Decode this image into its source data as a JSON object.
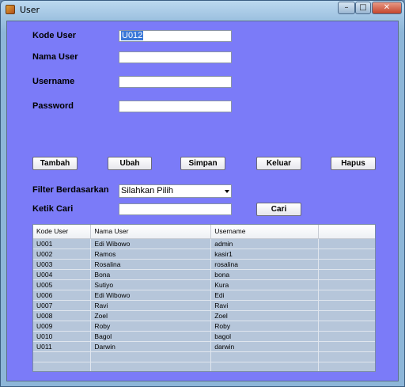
{
  "window": {
    "title": "User",
    "minimize": "–",
    "maximize": "□",
    "close": "✕"
  },
  "form": {
    "kode_user_label": "Kode User",
    "kode_user_value": "U012",
    "nama_user_label": "Nama User",
    "nama_user_value": "",
    "username_label": "Username",
    "username_value": "",
    "password_label": "Password",
    "password_value": ""
  },
  "buttons": {
    "tambah": "Tambah",
    "ubah": "Ubah",
    "simpan": "Simpan",
    "keluar": "Keluar",
    "hapus": "Hapus",
    "cari": "Cari"
  },
  "filter": {
    "label": "Filter Berdasarkan",
    "selected": "Silahkan Pilih",
    "search_label": "Ketik Cari",
    "search_value": ""
  },
  "table": {
    "headers": [
      "Kode User",
      "Nama User",
      "Username",
      ""
    ],
    "rows": [
      [
        "U001",
        "Edi Wibowo",
        "admin",
        ""
      ],
      [
        "U002",
        "Ramos",
        "kasir1",
        ""
      ],
      [
        "U003",
        "Rosalina",
        "rosalina",
        ""
      ],
      [
        "U004",
        "Bona",
        "bona",
        ""
      ],
      [
        "U005",
        "Sutiyo",
        "Kura",
        ""
      ],
      [
        "U006",
        "Edi Wibowo",
        "Edi",
        ""
      ],
      [
        "U007",
        "Ravi",
        "Ravi",
        ""
      ],
      [
        "U008",
        "Zoel",
        "Zoel",
        ""
      ],
      [
        "U009",
        "Roby",
        "Roby",
        ""
      ],
      [
        "U010",
        "Bagol",
        "bagol",
        ""
      ],
      [
        "U011",
        "Darwin",
        "darwin",
        ""
      ],
      [
        "",
        "",
        "",
        ""
      ],
      [
        "",
        "",
        "",
        ""
      ]
    ]
  }
}
